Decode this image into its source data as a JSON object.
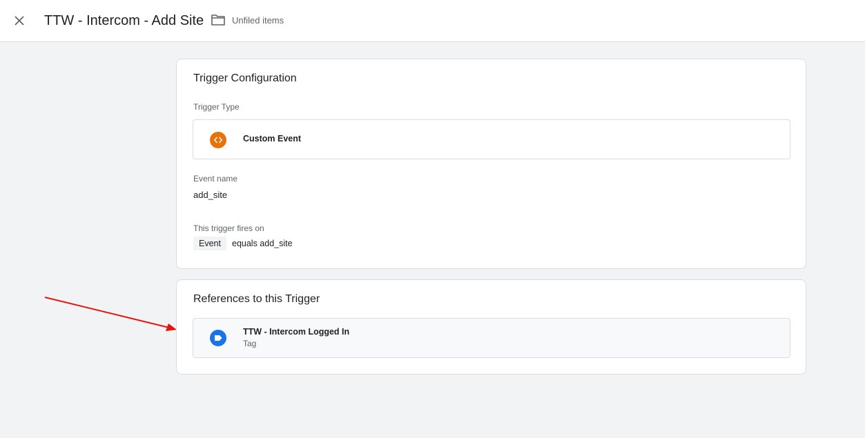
{
  "header": {
    "title": "TTW - Intercom - Add Site",
    "folder_label": "Unfiled items"
  },
  "config": {
    "title": "Trigger Configuration",
    "trigger_type_label": "Trigger Type",
    "trigger_type_value": "Custom Event",
    "event_name_label": "Event name",
    "event_name_value": "add_site",
    "fires_on_label": "This trigger fires on",
    "condition_variable": "Event",
    "condition_text": "equals add_site"
  },
  "references": {
    "title": "References to this Trigger",
    "items": [
      {
        "name": "TTW - Intercom Logged In",
        "type": "Tag"
      }
    ]
  },
  "colors": {
    "custom_event_icon": "#e8710a",
    "tag_icon": "#1a73e8",
    "annotation_arrow": "#e8130f"
  }
}
